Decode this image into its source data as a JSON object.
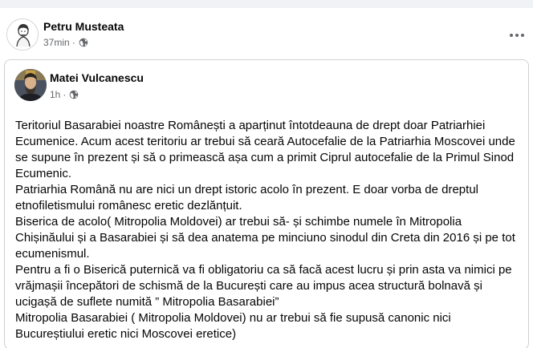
{
  "post": {
    "author": "Petru Musteata",
    "time": "37min",
    "separator": "·",
    "audience_icon": "globe-icon",
    "more_icon": "more-options-icon"
  },
  "shared_post": {
    "author": "Matei Vulcanescu",
    "time": "1h",
    "separator": "·",
    "audience_icon": "globe-icon",
    "paragraphs": [
      "Teritoriul Basarabiei noastre Românești a aparținut întotdeauna de drept doar Patriarhiei Ecumenice. Acum acest teritoriu ar trebui să ceară Autocefalie de la Patriarhia Moscovei unde se supune în prezent și să o primească așa cum a primit Ciprul autocefalie de  la Primul Sinod Ecumenic.",
      "Patriarhia Română nu are nici un drept istoric acolo în prezent. E doar vorba de dreptul etnofiletismului românesc eretic dezlănțuit.",
      "Biserica de acolo( Mitropolia Moldovei) ar trebui să- și schimbe numele în Mitropolia Chișinăului și a Basarabiei și să dea anatema pe minciuno sinodul din Creta din 2016 și pe tot ecumenismul.",
      "Pentru a fi o Biserică puternică va fi obligatoriu ca să facă acest lucru și prin asta va  nimici pe vrăjmașii începători de schismă  de la București care au impus acea structură bolnavă și ucigașă de suflete numită ” Mitropolia Basarabiei”",
      "Mitropolia Basarabiei ( Mitropolia Moldovei) nu ar trebui să fie supusă canonic nici Bucureștiului eretic nici Moscovei eretice)"
    ]
  },
  "colors": {
    "background": "#f0f2f5",
    "card": "#ffffff",
    "text": "#050505",
    "secondary_text": "#65676b",
    "border": "#ced0d4"
  }
}
